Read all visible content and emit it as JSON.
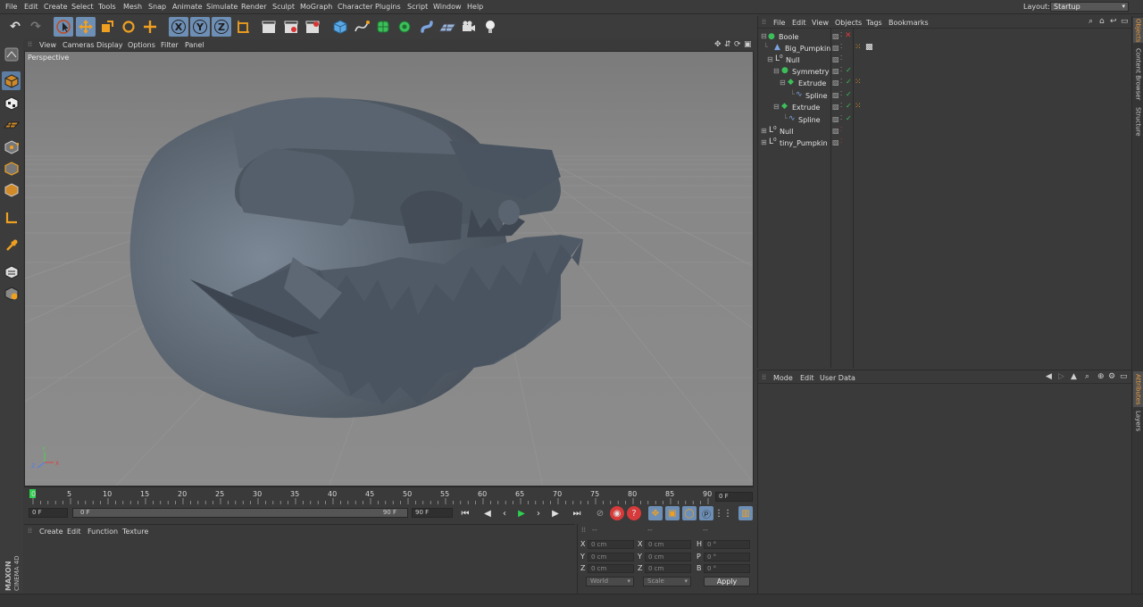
{
  "menubar": {
    "items": [
      "File",
      "Edit",
      "Create",
      "Select",
      "Tools",
      "Mesh",
      "Snap",
      "Animate",
      "Simulate",
      "Render",
      "Sculpt",
      "MoGraph",
      "Character",
      "Plugins",
      "Script",
      "Window",
      "Help"
    ],
    "layout_label": "Layout:",
    "layout_value": "Startup"
  },
  "viewport": {
    "menu": [
      "View",
      "Cameras",
      "Display",
      "Options",
      "Filter",
      "Panel"
    ],
    "label": "Perspective"
  },
  "timeline": {
    "ticks": [
      "0",
      "5",
      "10",
      "15",
      "20",
      "25",
      "30",
      "35",
      "40",
      "45",
      "50",
      "55",
      "60",
      "65",
      "70",
      "75",
      "80",
      "85",
      "90"
    ],
    "current_frame": "0 F",
    "start_frame": "0 F",
    "range_start": "0 F",
    "range_end": "90 F",
    "end_frame": "90 F"
  },
  "material_panel": {
    "menu": [
      "Create",
      "Edit",
      "Function",
      "Texture"
    ]
  },
  "coords": {
    "header": [
      "--",
      "--",
      "--"
    ],
    "rows": [
      {
        "a": "X",
        "av": "0 cm",
        "b": "X",
        "bv": "0 cm",
        "c": "H",
        "cv": "0 °"
      },
      {
        "a": "Y",
        "av": "0 cm",
        "b": "Y",
        "bv": "0 cm",
        "c": "P",
        "cv": "0 °"
      },
      {
        "a": "Z",
        "av": "0 cm",
        "b": "Z",
        "bv": "0 cm",
        "c": "B",
        "cv": "0 °"
      }
    ],
    "space": "World",
    "mode": "Scale",
    "apply": "Apply"
  },
  "object_manager": {
    "menu": [
      "File",
      "Edit",
      "View",
      "Objects",
      "Tags",
      "Bookmarks"
    ],
    "objects": [
      {
        "name": "Boole",
        "indent": 0
      },
      {
        "name": "Big_Pumpkin",
        "indent": 1
      },
      {
        "name": "Null",
        "indent": 1
      },
      {
        "name": "Symmetry",
        "indent": 2
      },
      {
        "name": "Extrude",
        "indent": 3
      },
      {
        "name": "Spline",
        "indent": 4
      },
      {
        "name": "Extrude",
        "indent": 2
      },
      {
        "name": "Spline",
        "indent": 3
      },
      {
        "name": "Null",
        "indent": 0
      },
      {
        "name": "tiny_Pumpkin",
        "indent": 0
      }
    ]
  },
  "attribute_manager": {
    "menu": [
      "Mode",
      "Edit",
      "User Data"
    ]
  },
  "right_tabs": {
    "top": [
      "Objects",
      "Content Browser",
      "Structure"
    ],
    "bottom": [
      "Attributes",
      "Layers"
    ]
  },
  "brand": {
    "line1": "MAXON",
    "line2": "CINEMA 4D"
  },
  "colors": {
    "accent": "#6e8fb5",
    "play": "#2fcf4f",
    "record": "#d63a3a",
    "highlight": "#f0a040"
  }
}
